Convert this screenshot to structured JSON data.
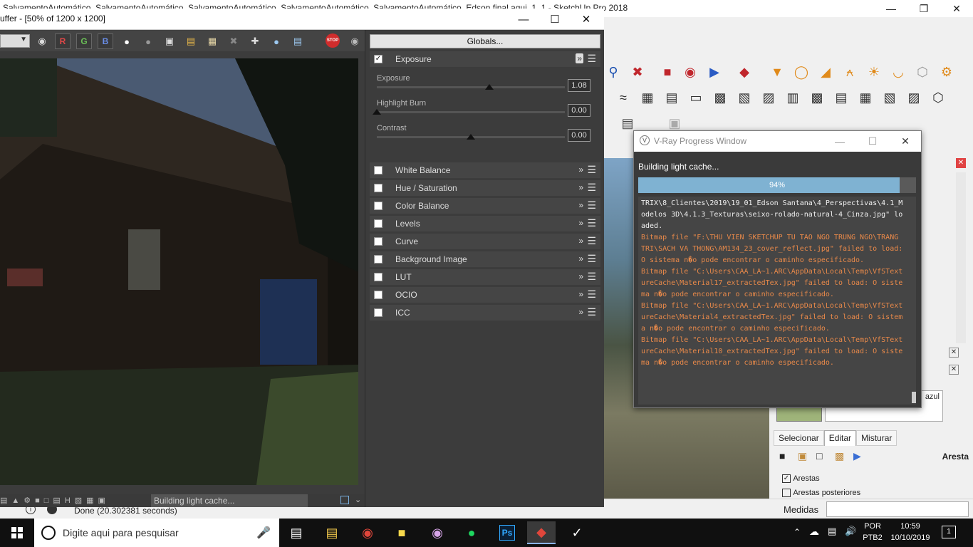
{
  "sketchup": {
    "title": "SalvamentoAutomático_SalvamentoAutomático_SalvamentoAutomático_SalvamentoAutomático_SalvamentoAutomático_Edson final aqui_1_1 - SketchUp Pro 2018",
    "window_controls": {
      "minimize": "—",
      "restore": "❐",
      "close": "✕"
    },
    "status_text": "Done (20.302381 seconds)",
    "measurements_label": "Medidas",
    "tray": {
      "material_name": "azul",
      "tabs": [
        "Selecionar",
        "Editar",
        "Misturar"
      ],
      "active_tab": "Editar",
      "section_label": "Aresta",
      "checkboxes": [
        {
          "label": "Arestas",
          "checked": true
        },
        {
          "label": "Arestas posteriores",
          "checked": false
        }
      ]
    }
  },
  "vfb": {
    "title": "uffer - [50% of 1200 x 1200]",
    "window_controls": {
      "minimize": "—",
      "maximize": "☐",
      "close": "✕"
    },
    "toolbar": {
      "r_label": "R",
      "g_label": "G",
      "b_label": "B",
      "stop_label": "STOP"
    },
    "globals_button": "Globals...",
    "exposure": {
      "label": "Exposure",
      "enabled": true,
      "sliders": [
        {
          "name": "Exposure",
          "value": "1.08",
          "level": 0.6
        },
        {
          "name": "Highlight Burn",
          "value": "0.00",
          "level": 0.0
        },
        {
          "name": "Contrast",
          "value": "0.00",
          "level": 0.5
        }
      ]
    },
    "layers": [
      {
        "label": "White Balance",
        "enabled": false
      },
      {
        "label": "Hue / Saturation",
        "enabled": false
      },
      {
        "label": "Color Balance",
        "enabled": false
      },
      {
        "label": "Levels",
        "enabled": false
      },
      {
        "label": "Curve",
        "enabled": false
      },
      {
        "label": "Background Image",
        "enabled": false
      },
      {
        "label": "LUT",
        "enabled": false
      },
      {
        "label": "OCIO",
        "enabled": false
      },
      {
        "label": "ICC",
        "enabled": false
      }
    ],
    "status_message": "Building light cache..."
  },
  "progress_window": {
    "title": "V-Ray Progress Window",
    "status": "Building light cache...",
    "progress": 0.94,
    "progress_label": "94%",
    "log": [
      {
        "type": "ok",
        "text": "TRIX\\8_Clientes\\2019\\19_01_Edson Santana\\4_Perspectivas\\4.1_Modelos 3D\\4.1.3_Texturas\\seixo-rolado-natural-4_Cinza.jpg\" loaded."
      },
      {
        "type": "err",
        "text": "Bitmap file \"F:\\THU VIEN SKETCHUP TU TAO NGO TRUNG NGO\\TRANG TRI\\SACH VA THONG\\AM134_23_cover_reflect.jpg\" failed to load: O sistema n�o pode encontrar o caminho especificado."
      },
      {
        "type": "err",
        "text": "Bitmap file \"C:\\Users\\CAA_LA~1.ARC\\AppData\\Local\\Temp\\VfSTextureCache\\Material17_extractedTex.jpg\" failed to load: O sistema n�o pode encontrar o caminho especificado."
      },
      {
        "type": "err",
        "text": "Bitmap file \"C:\\Users\\CAA_LA~1.ARC\\AppData\\Local\\Temp\\VfSTextureCache\\Material4_extractedTex.jpg\" failed to load: O sistema n�o pode encontrar o caminho especificado."
      },
      {
        "type": "err",
        "text": "Bitmap file \"C:\\Users\\CAA_LA~1.ARC\\AppData\\Local\\Temp\\VfSTextureCache\\Material10_extractedTex.jpg\" failed to load: O sistema n�o pode encontrar o caminho especificado."
      }
    ]
  },
  "taskbar": {
    "search_placeholder": "Digite aqui para pesquisar",
    "apps": [
      "task-view",
      "file-explorer",
      "chrome",
      "sticky-notes",
      "paint",
      "spotify",
      "photoshop",
      "sketchup",
      "vray"
    ],
    "photoshop_label": "Ps",
    "language": "POR",
    "keyboard": "PTB2",
    "time": "10:59",
    "date": "10/10/2019",
    "notification_count": "1"
  }
}
